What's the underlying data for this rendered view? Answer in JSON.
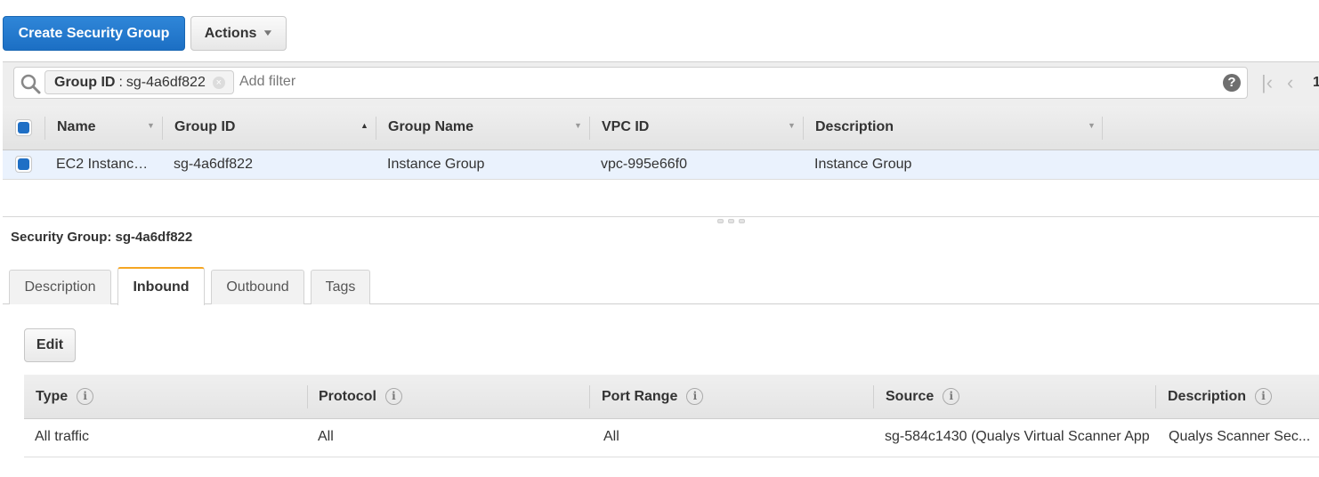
{
  "toolbar": {
    "create_label": "Create Security Group",
    "actions_label": "Actions",
    "actions_icon": "chevron-down-icon"
  },
  "filter": {
    "chip_key": "Group ID",
    "chip_sep": ":",
    "chip_value": "sg-4a6df822",
    "placeholder": "Add filter",
    "help_icon": "?",
    "pager_page": "1"
  },
  "main_table": {
    "columns": [
      {
        "label": "Name",
        "sort": "▼"
      },
      {
        "label": "Group ID",
        "sort": "▲"
      },
      {
        "label": "Group Name",
        "sort": "▼"
      },
      {
        "label": "VPC ID",
        "sort": "▼"
      },
      {
        "label": "Description",
        "sort": "▼"
      }
    ],
    "rows": [
      {
        "name": "EC2 Instanc…",
        "group_id": "sg-4a6df822",
        "group_name": "Instance Group",
        "vpc_id": "vpc-995e66f0",
        "description": "Instance Group",
        "selected": true
      }
    ]
  },
  "detail": {
    "title": "Security Group: sg-4a6df822",
    "tabs": [
      {
        "label": "Description",
        "active": false
      },
      {
        "label": "Inbound",
        "active": true
      },
      {
        "label": "Outbound",
        "active": false
      },
      {
        "label": "Tags",
        "active": false
      }
    ],
    "edit_label": "Edit",
    "rules": {
      "columns": [
        "Type",
        "Protocol",
        "Port Range",
        "Source",
        "Description"
      ],
      "rows": [
        {
          "type": "All traffic",
          "protocol": "All",
          "port_range": "All",
          "source": "sg-584c1430 (Qualys Virtual Scanner App",
          "description": "Qualys Scanner Sec..."
        }
      ]
    }
  },
  "colors": {
    "primary": "#1f6fc5",
    "active_tab_accent": "#f5a623",
    "selected_row": "#eaf2fd"
  }
}
